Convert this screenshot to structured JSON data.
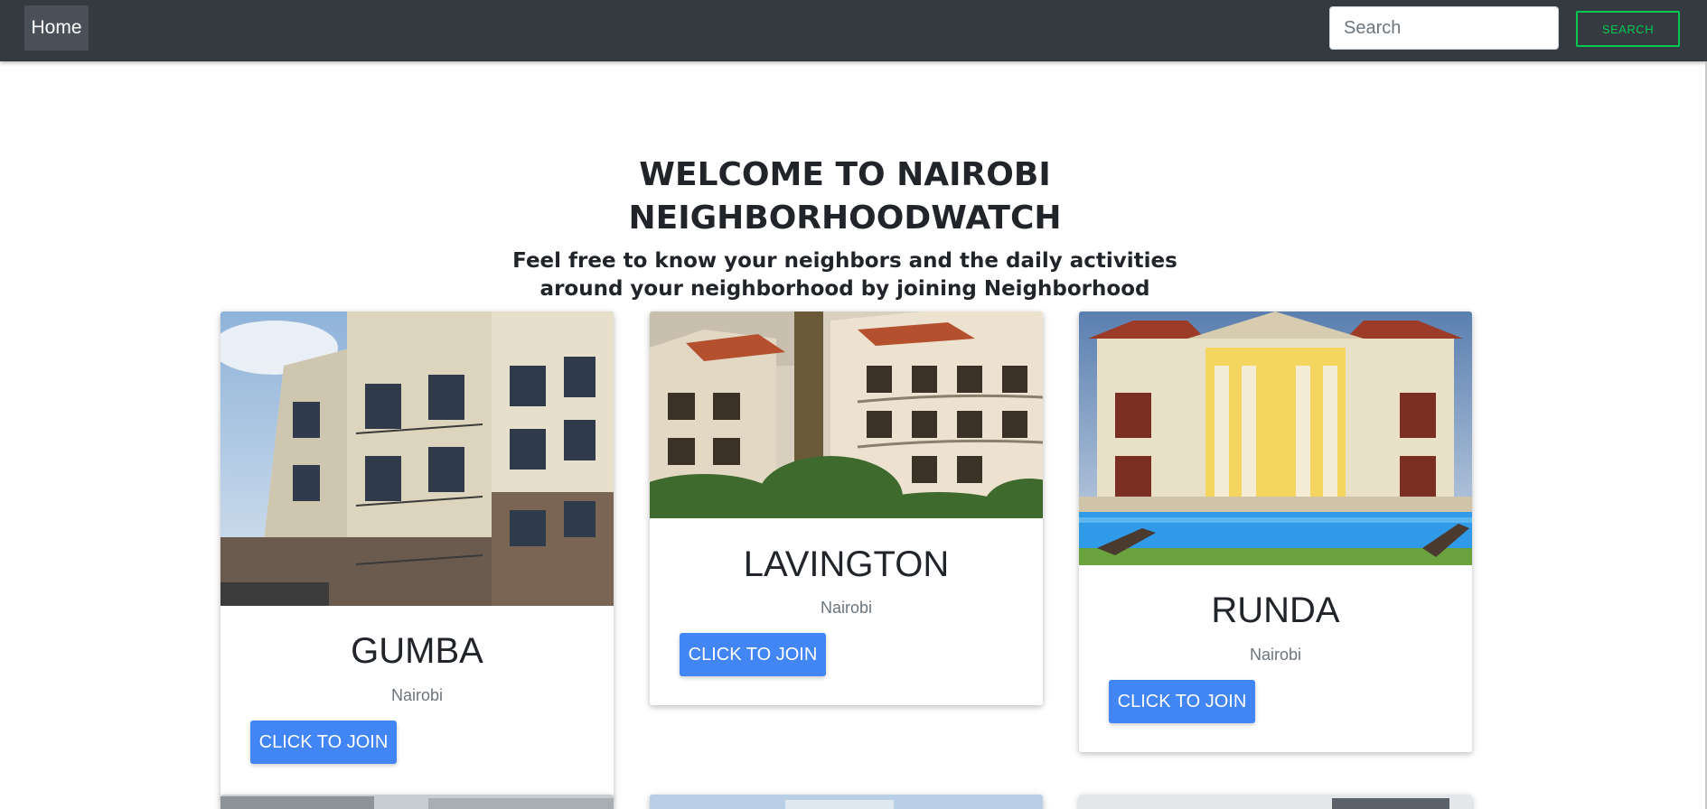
{
  "navbar": {
    "home_label": "Home",
    "search_placeholder": "Search",
    "search_button_label": "SEARCH",
    "background_color": "#343a40",
    "search_accent_color": "#00c851"
  },
  "hero": {
    "title_line1": "WELCOME TO NAIROBI",
    "title_line2": "NEIGHBORHOODWATCH",
    "subtitle_line1": "Feel free to know your neighbors and the daily activities",
    "subtitle_line2": "around your neighborhood by joining Neighborhood"
  },
  "neighborhoods": [
    {
      "name": "GUMBA",
      "city": "Nairobi",
      "join_label": "CLICK TO JOIN"
    },
    {
      "name": "LAVINGTON",
      "city": "Nairobi",
      "join_label": "CLICK TO JOIN"
    },
    {
      "name": "RUNDA",
      "city": "Nairobi",
      "join_label": "CLICK TO JOIN"
    }
  ],
  "colors": {
    "primary_button": "#4285f4"
  }
}
